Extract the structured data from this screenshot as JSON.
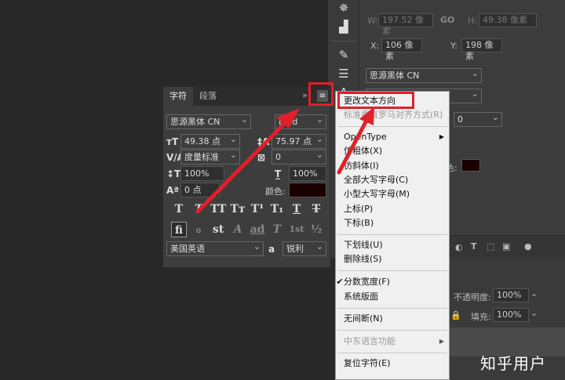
{
  "colors": {
    "accent_red": "#e0202a",
    "menu_bg": "#f0f0f0",
    "panel_bg": "#3d3d3d",
    "canvas_bg": "#282828"
  },
  "properties": {
    "w_label": "W:",
    "w_value": "197.52 像素",
    "go_label": "GO",
    "h_label": "H:",
    "h_value": "49.38 像素",
    "x_label": "X:",
    "x_value": "106 像素",
    "y_label": "Y:",
    "y_value": "198 像素",
    "font_family": "思源黑体 CN",
    "tracking_value": "0",
    "color_label": "色:",
    "opacity_label": "不透明度:",
    "opacity_value": "100%",
    "fill_label": "填充:",
    "fill_value": "100%"
  },
  "char_panel": {
    "tabs": [
      {
        "label": "字符"
      },
      {
        "label": "段落"
      }
    ],
    "collapse_icon": "»",
    "menu_icon": "≡",
    "font_family": "思源黑体 CN",
    "font_style": "Bold",
    "font_size": "49.38 点",
    "leading": "75.97 点",
    "kerning": "度量标准",
    "tracking": "0",
    "vertical_scale": "100%",
    "horizontal_scale": "100%",
    "baseline_shift": "0 点",
    "color_label": "颜色:",
    "language": "美国英语",
    "aa_label": "a",
    "antialias": "锐利",
    "type_buttons_row1": [
      "T",
      "T",
      "TT",
      "Tт",
      "T¹",
      "T₁",
      "T",
      "T"
    ],
    "type_buttons_row2": [
      "fi",
      "ℴ",
      "st",
      "A",
      "ad",
      "T",
      "1st",
      "½"
    ]
  },
  "menu": {
    "items": [
      {
        "label": "更改文本方向"
      },
      {
        "label": "标准垂直罗马对齐方式(R)"
      },
      {
        "label": "OpenType"
      },
      {
        "label": "仿粗体(X)"
      },
      {
        "label": "仿斜体(I)"
      },
      {
        "label": "全部大写字母(C)"
      },
      {
        "label": "小型大写字母(M)"
      },
      {
        "label": "上标(P)"
      },
      {
        "label": "下标(B)"
      },
      {
        "label": "下划线(U)"
      },
      {
        "label": "删除线(S)"
      },
      {
        "label": "分数宽度(F)"
      },
      {
        "label": "系统版面"
      },
      {
        "label": "无间断(N)"
      },
      {
        "label": "中东语言功能"
      },
      {
        "label": "复位字符(E)"
      }
    ]
  },
  "watermark": "知乎用户"
}
